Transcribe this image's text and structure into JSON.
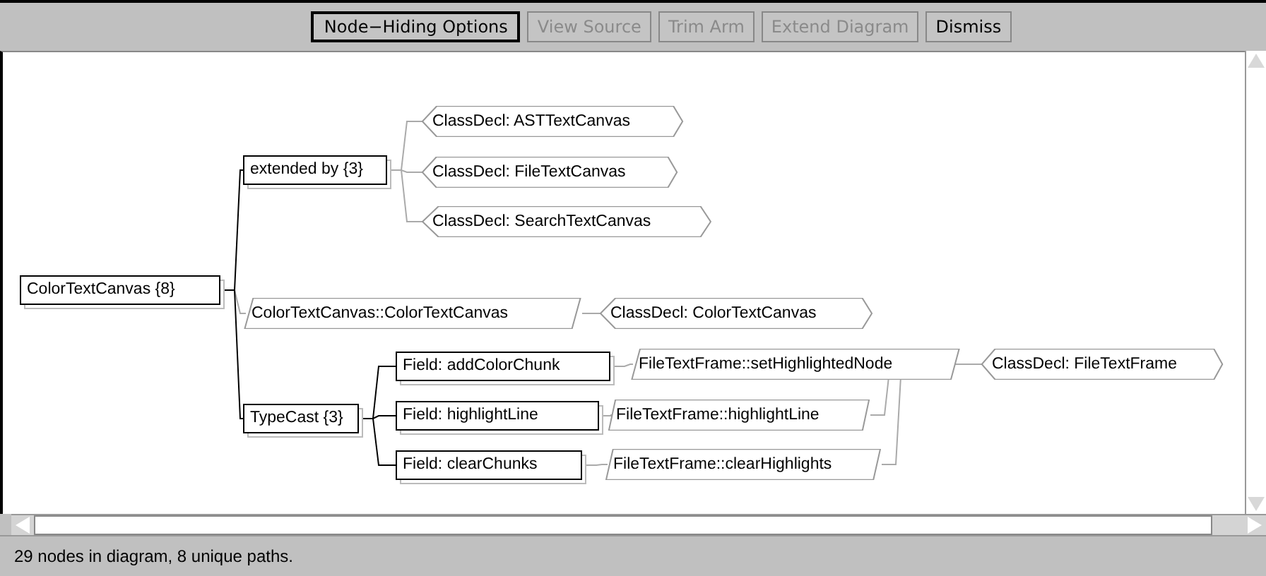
{
  "toolbar": {
    "buttons": [
      {
        "label": "Node−Hiding Options",
        "disabled": false,
        "default": true
      },
      {
        "label": "View Source",
        "disabled": true,
        "default": false
      },
      {
        "label": "Trim Arm",
        "disabled": true,
        "default": false
      },
      {
        "label": "Extend Diagram",
        "disabled": true,
        "default": false
      },
      {
        "label": "Dismiss",
        "disabled": false,
        "default": false
      }
    ]
  },
  "diagram": {
    "nodes": [
      {
        "label": "ColorTextCanvas {8}",
        "kind": "box"
      },
      {
        "label": "extended by {3}",
        "kind": "box"
      },
      {
        "label": "ClassDecl: ASTTextCanvas",
        "kind": "hex"
      },
      {
        "label": "ClassDecl: FileTextCanvas",
        "kind": "hex"
      },
      {
        "label": "ClassDecl: SearchTextCanvas",
        "kind": "hex"
      },
      {
        "label": "ColorTextCanvas::ColorTextCanvas",
        "kind": "para"
      },
      {
        "label": "ClassDecl: ColorTextCanvas",
        "kind": "hex"
      },
      {
        "label": "TypeCast {3}",
        "kind": "box"
      },
      {
        "label": "Field: addColorChunk",
        "kind": "box"
      },
      {
        "label": "Field: highlightLine",
        "kind": "box"
      },
      {
        "label": "Field: clearChunks",
        "kind": "box"
      },
      {
        "label": "FileTextFrame::setHighlightedNode",
        "kind": "para"
      },
      {
        "label": "FileTextFrame::highlightLine",
        "kind": "para"
      },
      {
        "label": "FileTextFrame::clearHighlights",
        "kind": "para"
      },
      {
        "label": "ClassDecl: FileTextFrame",
        "kind": "hex"
      }
    ]
  },
  "status_bar": "29 nodes in diagram, 8 unique paths."
}
